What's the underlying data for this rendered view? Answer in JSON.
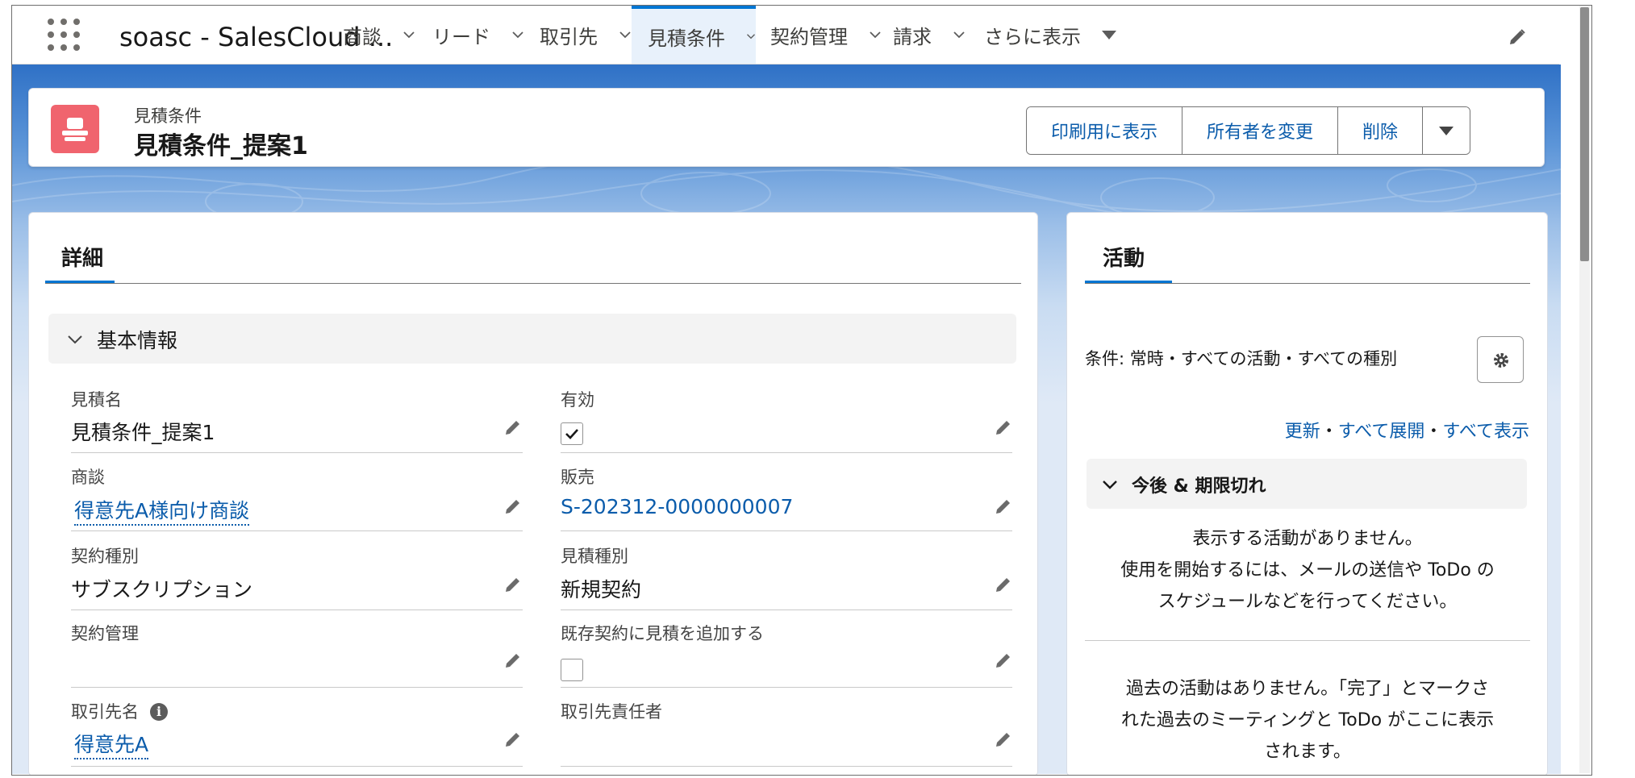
{
  "app": {
    "name": "soasc - SalesCloud ..."
  },
  "nav": {
    "items": [
      {
        "label": "商談"
      },
      {
        "label": "リード"
      },
      {
        "label": "取引先"
      },
      {
        "label": "見積条件"
      },
      {
        "label": "契約管理"
      },
      {
        "label": "請求"
      }
    ],
    "more_label": "さらに表示",
    "active_index": 3
  },
  "record": {
    "type_label": "見積条件",
    "title": "見積条件_提案1",
    "icon_color": "#f0646e",
    "actions": {
      "print_label": "印刷用に表示",
      "change_owner_label": "所有者を変更",
      "delete_label": "削除"
    }
  },
  "detail": {
    "tab_label": "詳細",
    "section_label": "基本情報",
    "fields": {
      "quote_name": {
        "label": "見積名",
        "value": "見積条件_提案1"
      },
      "active": {
        "label": "有効",
        "checked": true
      },
      "opportunity": {
        "label": "商談",
        "value": "得意先A様向け商談"
      },
      "sales": {
        "label": "販売",
        "value": "S-202312-0000000007"
      },
      "contract_type": {
        "label": "契約種別",
        "value": "サブスクリプション"
      },
      "quote_type": {
        "label": "見積種別",
        "value": "新規契約"
      },
      "contract_mgmt": {
        "label": "契約管理",
        "value": ""
      },
      "add_to_existing": {
        "label": "既存契約に見積を追加する",
        "checked": false
      },
      "account_name": {
        "label": "取引先名",
        "value": "得意先A"
      },
      "account_contact": {
        "label": "取引先責任者",
        "value": ""
      }
    }
  },
  "activity": {
    "tab_label": "活動",
    "filter_text": "条件: 常時・すべての活動・すべての種別",
    "links": {
      "refresh": "更新",
      "expand_all": "すべて展開",
      "view_all": "すべて表示",
      "separator": "・"
    },
    "upcoming_label": "今後 & 期限切れ",
    "empty_line1": "表示する活動がありません。",
    "empty_line2": "使用を開始するには、メールの送信や ToDo の",
    "empty_line3": "スケジュールなどを行ってください。",
    "past_line1": "過去の活動はありません。「完了」とマークさ",
    "past_line2": "れた過去のミーティングと ToDo がここに表示",
    "past_line3": "されます。"
  },
  "colors": {
    "accent": "#0176d3",
    "link": "#0b5cab",
    "brand_band": "#2f71c6"
  }
}
